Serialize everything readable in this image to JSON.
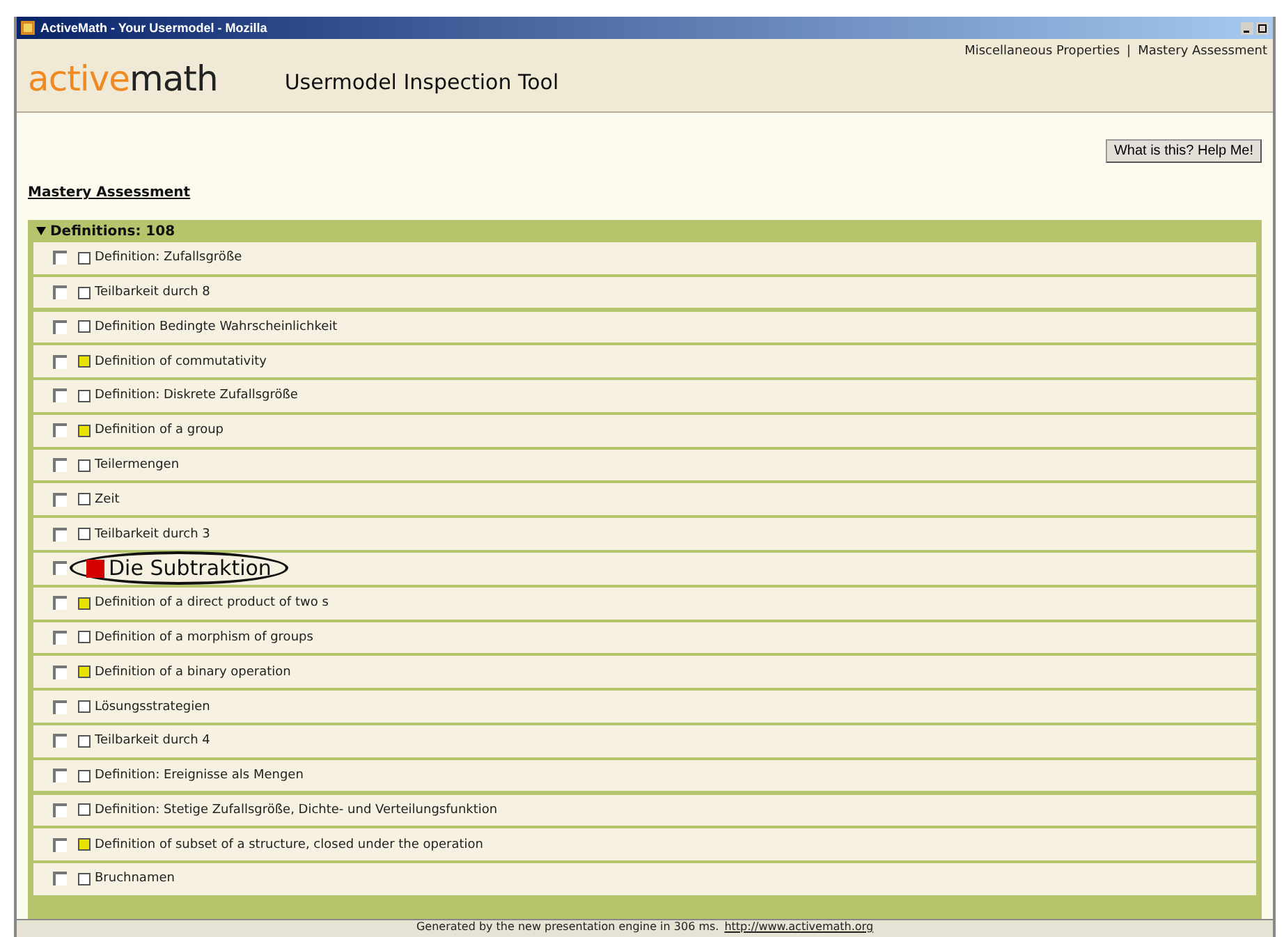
{
  "window": {
    "title": "ActiveMath - Your Usermodel - Mozilla"
  },
  "header": {
    "logo_left": "active",
    "logo_right": "math",
    "title": "Usermodel Inspection Tool",
    "links": [
      "Miscellaneous Properties",
      "Mastery Assessment"
    ],
    "link_separator": "|"
  },
  "help_button": "What is this? Help Me!",
  "section_title": "Mastery Assessment",
  "group": {
    "label": "Definitions: 108",
    "expanded": true,
    "items": [
      {
        "label": "Definition: Zufallsgröße",
        "checked": false,
        "color": "#ffffff",
        "highlighted": false
      },
      {
        "label": "Teilbarkeit durch 8",
        "checked": false,
        "color": "#ffffff",
        "highlighted": false
      },
      {
        "label": "Definition Bedingte Wahrscheinlichkeit",
        "checked": false,
        "color": "#ffffff",
        "highlighted": false
      },
      {
        "label": "Definition of commutativity",
        "checked": false,
        "color": "#e8e400",
        "highlighted": false
      },
      {
        "label": "Definition: Diskrete Zufallsgröße",
        "checked": false,
        "color": "#ffffff",
        "highlighted": false
      },
      {
        "label": "Definition of a group",
        "checked": false,
        "color": "#e8e400",
        "highlighted": false
      },
      {
        "label": "Teilermengen",
        "checked": false,
        "color": "#ffffff",
        "highlighted": false
      },
      {
        "label": "Zeit",
        "checked": false,
        "color": "#ffffff",
        "highlighted": false
      },
      {
        "label": "Teilbarkeit durch 3",
        "checked": false,
        "color": "#ffffff",
        "highlighted": false
      },
      {
        "label": "Die Subtraktion",
        "checked": false,
        "color": "#d40000",
        "highlighted": true
      },
      {
        "label": "Definition of a direct product of two s",
        "checked": false,
        "color": "#e8e400",
        "highlighted": false
      },
      {
        "label": "Definition of a morphism of groups",
        "checked": false,
        "color": "#ffffff",
        "highlighted": false
      },
      {
        "label": "Definition of a binary operation",
        "checked": false,
        "color": "#e8e400",
        "highlighted": false
      },
      {
        "label": "Lösungsstrategien",
        "checked": false,
        "color": "#ffffff",
        "highlighted": false
      },
      {
        "label": "Teilbarkeit durch 4",
        "checked": false,
        "color": "#ffffff",
        "highlighted": false
      },
      {
        "label": "Definition: Ereignisse als Mengen",
        "checked": false,
        "color": "#ffffff",
        "highlighted": false
      },
      {
        "label": "Definition: Stetige Zufallsgröße, Dichte- und Verteilungsfunktion",
        "checked": false,
        "color": "#ffffff",
        "highlighted": false
      },
      {
        "label": "Definition of subset of a structure, closed under the operation",
        "checked": false,
        "color": "#e8e400",
        "highlighted": false
      },
      {
        "label": "Bruchnamen",
        "checked": false,
        "color": "#ffffff",
        "highlighted": false
      }
    ]
  },
  "footer": {
    "text": "Generated by the new presentation engine in 306 ms.",
    "link": "http://www.activemath.org"
  }
}
